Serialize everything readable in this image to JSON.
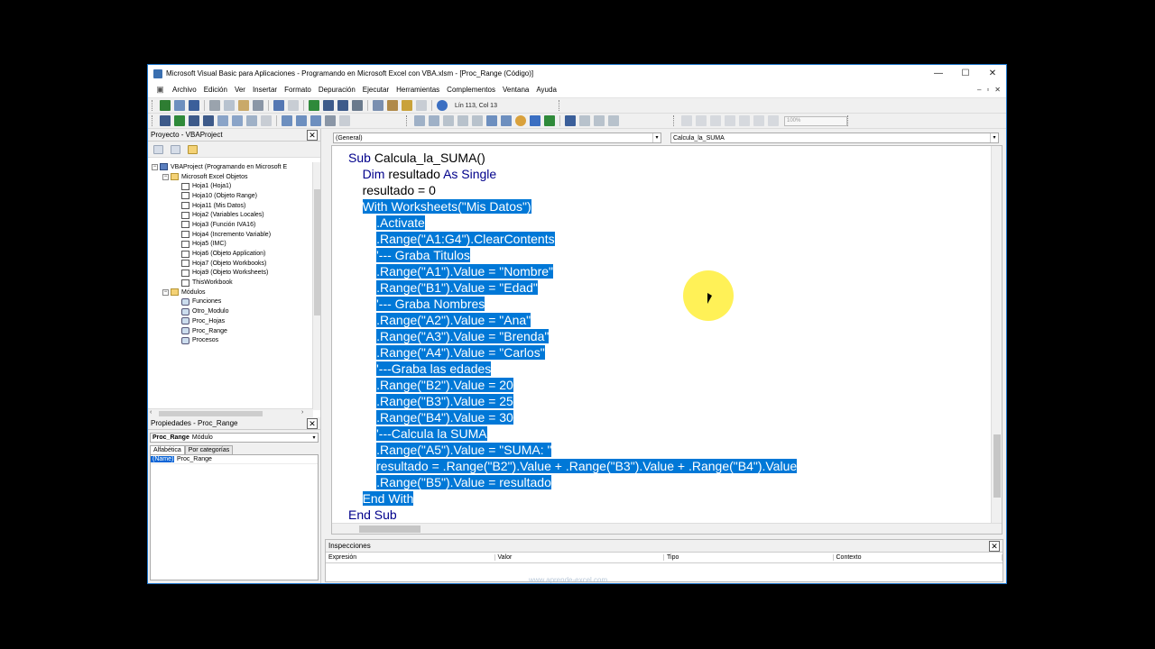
{
  "window": {
    "title": "Microsoft Visual Basic para Aplicaciones - Programando en Microsoft Excel con VBA.xlsm - [Proc_Range (Código)]",
    "minimize_glyph": "—",
    "maximize_glyph": "☐",
    "close_glyph": "✕"
  },
  "menu": {
    "items": [
      "Archivo",
      "Edición",
      "Ver",
      "Insertar",
      "Formato",
      "Depuración",
      "Ejecutar",
      "Herramientas",
      "Complementos",
      "Ventana",
      "Ayuda"
    ],
    "mdi_min": "–",
    "mdi_restore": "▫",
    "mdi_close": "✕"
  },
  "toolbar": {
    "position": "Lín 113, Col 13",
    "zoom": "100%"
  },
  "project": {
    "title": "Proyecto - VBAProject",
    "close": "✕",
    "tree": [
      {
        "label": "VBAProject (Programando en Microsoft E",
        "level": 0,
        "icon": "project-icon",
        "expander": "−"
      },
      {
        "label": "Microsoft Excel Objetos",
        "level": 1,
        "icon": "folder-icon",
        "expander": "−"
      },
      {
        "label": "Hoja1 (Hoja1)",
        "level": 2,
        "icon": "sheet-icon"
      },
      {
        "label": "Hoja10 (Objeto Range)",
        "level": 2,
        "icon": "sheet-icon"
      },
      {
        "label": "Hoja11 (Mis Datos)",
        "level": 2,
        "icon": "sheet-icon"
      },
      {
        "label": "Hoja2 (Variables Locales)",
        "level": 2,
        "icon": "sheet-icon"
      },
      {
        "label": "Hoja3 (Función IVA16)",
        "level": 2,
        "icon": "sheet-icon"
      },
      {
        "label": "Hoja4 (Incremento Variable)",
        "level": 2,
        "icon": "sheet-icon"
      },
      {
        "label": "Hoja5 (IMC)",
        "level": 2,
        "icon": "sheet-icon"
      },
      {
        "label": "Hoja6 (Objeto Application)",
        "level": 2,
        "icon": "sheet-icon"
      },
      {
        "label": "Hoja7 (Objeto Workbooks)",
        "level": 2,
        "icon": "sheet-icon"
      },
      {
        "label": "Hoja9 (Objeto Worksheets)",
        "level": 2,
        "icon": "sheet-icon"
      },
      {
        "label": "ThisWorkbook",
        "level": 2,
        "icon": "sheet-icon"
      },
      {
        "label": "Módulos",
        "level": 1,
        "icon": "folder-icon",
        "expander": "−"
      },
      {
        "label": "Funciones",
        "level": 2,
        "icon": "module-icon"
      },
      {
        "label": "Otro_Modulo",
        "level": 2,
        "icon": "module-icon"
      },
      {
        "label": "Proc_Hojas",
        "level": 2,
        "icon": "module-icon"
      },
      {
        "label": "Proc_Range",
        "level": 2,
        "icon": "module-icon"
      },
      {
        "label": "Procesos",
        "level": 2,
        "icon": "module-icon"
      }
    ],
    "scroll_left": "‹",
    "scroll_right": "›"
  },
  "properties": {
    "title": "Propiedades - Proc_Range",
    "close": "✕",
    "object_name": "Proc_Range",
    "object_type": "Módulo",
    "tabs": [
      "Alfabética",
      "Por categorías"
    ],
    "rows": [
      {
        "name": "(Name)",
        "value": "Proc_Range"
      }
    ]
  },
  "editor": {
    "object_combo": "(General)",
    "proc_combo": "Calcula_la_SUMA",
    "dropdown": "▾",
    "code": [
      {
        "parts": [
          {
            "t": "Sub ",
            "kw": true
          },
          {
            "t": "Calcula_la_SUMA()"
          }
        ]
      },
      {
        "indent": "    ",
        "parts": [
          {
            "t": "Dim ",
            "kw": true
          },
          {
            "t": "resultado "
          },
          {
            "t": "As Single",
            "kw": true
          }
        ]
      },
      {
        "indent": "    ",
        "parts": [
          {
            "t": "resultado = 0"
          }
        ]
      },
      {
        "indent": "    ",
        "hl": true,
        "parts": [
          {
            "t": "With Worksheets(\"Mis Datos\")"
          }
        ]
      },
      {
        "indent": "        ",
        "hl": true,
        "parts": [
          {
            "t": ".Activate"
          }
        ]
      },
      {
        "indent": "        ",
        "hl": true,
        "parts": [
          {
            "t": ".Range(\"A1:G4\").ClearContents"
          }
        ]
      },
      {
        "indent": "        ",
        "hl": true,
        "parts": [
          {
            "t": "'--- Graba Titulos"
          }
        ]
      },
      {
        "indent": "        ",
        "hl": true,
        "parts": [
          {
            "t": ".Range(\"A1\").Value = \"Nombre\""
          }
        ]
      },
      {
        "indent": "        ",
        "hl": true,
        "parts": [
          {
            "t": ".Range(\"B1\").Value = \"Edad\""
          }
        ]
      },
      {
        "indent": "        ",
        "hl": true,
        "parts": [
          {
            "t": "'--- Graba Nombres"
          }
        ]
      },
      {
        "indent": "        ",
        "hl": true,
        "parts": [
          {
            "t": ".Range(\"A2\").Value = \"Ana\""
          }
        ]
      },
      {
        "indent": "        ",
        "hl": true,
        "parts": [
          {
            "t": ".Range(\"A3\").Value = \"Brenda\""
          }
        ]
      },
      {
        "indent": "        ",
        "hl": true,
        "parts": [
          {
            "t": ".Range(\"A4\").Value = \"Carlos\""
          }
        ]
      },
      {
        "indent": "        ",
        "hl": true,
        "parts": [
          {
            "t": "'---Graba las edades"
          }
        ]
      },
      {
        "indent": "        ",
        "hl": true,
        "parts": [
          {
            "t": ".Range(\"B2\").Value = 20"
          }
        ]
      },
      {
        "indent": "        ",
        "hl": true,
        "parts": [
          {
            "t": ".Range(\"B3\").Value = 25"
          }
        ]
      },
      {
        "indent": "        ",
        "hl": true,
        "parts": [
          {
            "t": ".Range(\"B4\").Value = 30"
          }
        ]
      },
      {
        "indent": "        ",
        "hl": true,
        "parts": [
          {
            "t": "'---Calcula la SUMA"
          }
        ]
      },
      {
        "indent": "        ",
        "hl": true,
        "parts": [
          {
            "t": ".Range(\"A5\").Value = \"SUMA: \""
          }
        ]
      },
      {
        "indent": "        ",
        "hl": true,
        "parts": [
          {
            "t": "resultado = .Range(\"B2\").Value + .Range(\"B3\").Value + .Range(\"B4\").Value"
          }
        ]
      },
      {
        "indent": "        ",
        "hl": true,
        "parts": [
          {
            "t": ".Range(\"B5\").Value = resultado"
          }
        ]
      },
      {
        "indent": "    ",
        "hl": true,
        "parts": [
          {
            "t": "End With"
          }
        ]
      },
      {
        "parts": [
          {
            "t": "End Sub",
            "kw": true
          }
        ]
      }
    ]
  },
  "watch": {
    "title": "Inspecciones",
    "close": "✕",
    "columns": [
      "Expresión",
      "Valor",
      "Tipo",
      "Contexto"
    ]
  },
  "watermark": "www.aprende-excel.com",
  "colors": {
    "selection": "#0078d7",
    "keyword": "#00008b",
    "cursor_highlight": "#ffef3a"
  }
}
